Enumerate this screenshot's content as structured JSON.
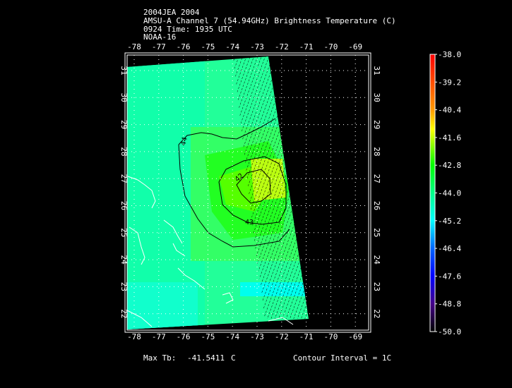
{
  "title": {
    "line1": "2004JEA 2004",
    "line2": "AMSU-A Channel 7 (54.94GHz) Brightness Temperature (C)",
    "line3": "0924 Time: 1935 UTC",
    "line4": "NOAA-16"
  },
  "map": {
    "lon_ticks": [
      "-78",
      "-77",
      "-76",
      "-75",
      "-74",
      "-73",
      "-72",
      "-71",
      "-70",
      "-69"
    ],
    "lat_ticks": [
      "31",
      "30",
      "29",
      "28",
      "27",
      "26",
      "25",
      "24",
      "23",
      "22"
    ],
    "contour_labels": [
      "44",
      "42",
      "43"
    ]
  },
  "colorbar": {
    "ticks": [
      "-38.0",
      "-39.2",
      "-40.4",
      "-41.6",
      "-42.8",
      "-44.0",
      "-45.2",
      "-46.4",
      "-47.6",
      "-48.8",
      "-50.0"
    ]
  },
  "footer": {
    "max_tb_label": "Max Tb:",
    "max_tb_value": "-41.5411",
    "max_tb_unit": "C",
    "contour_interval": "Contour Interval = 1C"
  }
}
